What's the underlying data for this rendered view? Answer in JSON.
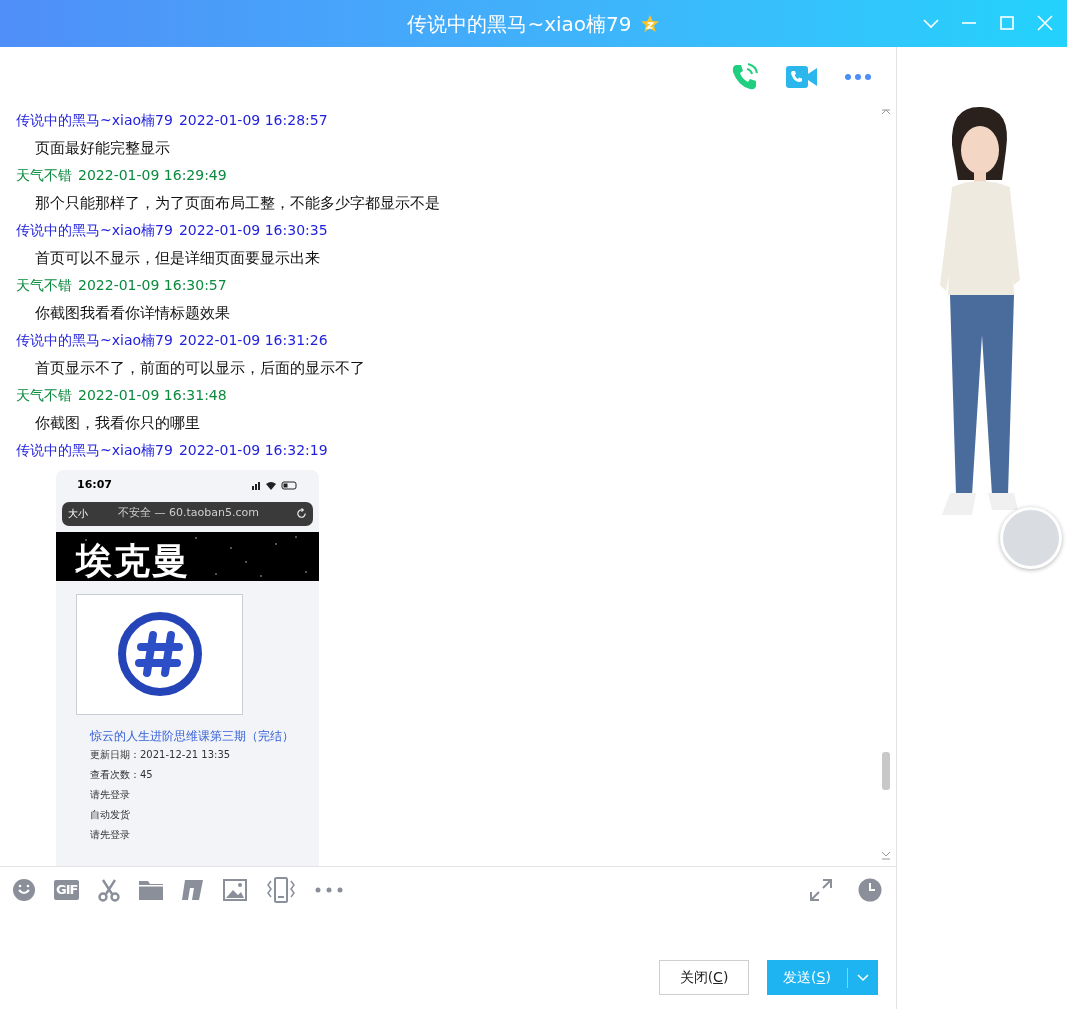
{
  "window": {
    "title": "传说中的黑马~xiao楠79"
  },
  "messages": [
    {
      "sender": "传说中的黑马~xiao楠79",
      "time": "2022-01-09 16:28:57",
      "color": "#1f1fdc",
      "kind": "text",
      "text": "页面最好能完整显示"
    },
    {
      "sender": "天气不错",
      "time": "2022-01-09 16:29:49",
      "color": "#0b8a3e",
      "kind": "text",
      "text": "那个只能那样了，为了页面布局工整，不能多少字都显示不是"
    },
    {
      "sender": "传说中的黑马~xiao楠79",
      "time": "2022-01-09 16:30:35",
      "color": "#1f1fdc",
      "kind": "text",
      "text": "首页可以不显示，但是详细页面要显示出来"
    },
    {
      "sender": "天气不错",
      "time": "2022-01-09 16:30:57",
      "color": "#0b8a3e",
      "kind": "text",
      "text": "你截图我看看你详情标题效果"
    },
    {
      "sender": "传说中的黑马~xiao楠79",
      "time": "2022-01-09 16:31:26",
      "color": "#1f1fdc",
      "kind": "text",
      "text": "首页显示不了，前面的可以显示，后面的显示不了"
    },
    {
      "sender": "天气不错",
      "time": "2022-01-09 16:31:48",
      "color": "#0b8a3e",
      "kind": "text",
      "text": "你截图，我看你只的哪里"
    },
    {
      "sender": "传说中的黑马~xiao楠79",
      "time": "2022-01-09 16:32:19",
      "color": "#1f1fdc",
      "kind": "image"
    }
  ],
  "shared_screenshot": {
    "clock": "16:07",
    "text_size": "大小",
    "url": "不安全 — 60.taoban5.com",
    "banner": "埃克曼",
    "title": "惊云的人生进阶思维课第三期（完结）",
    "details": [
      "更新日期：2021-12-21 13:35",
      "查看次数：45",
      "请先登录",
      "自动发货",
      "请先登录"
    ]
  },
  "toolbar": {
    "tools": [
      {
        "kind": "emoji"
      },
      {
        "kind": "gif",
        "text": "GIF"
      },
      {
        "kind": "scissors"
      },
      {
        "kind": "folder"
      },
      {
        "kind": "redpacket"
      },
      {
        "kind": "image"
      },
      {
        "kind": "shake"
      },
      {
        "kind": "more"
      }
    ]
  },
  "buttons": [
    {
      "kind": "close",
      "parts": [
        "关闭(",
        "C",
        ")"
      ]
    },
    {
      "kind": "send",
      "parts": [
        "发送(",
        "S",
        ")"
      ]
    }
  ]
}
